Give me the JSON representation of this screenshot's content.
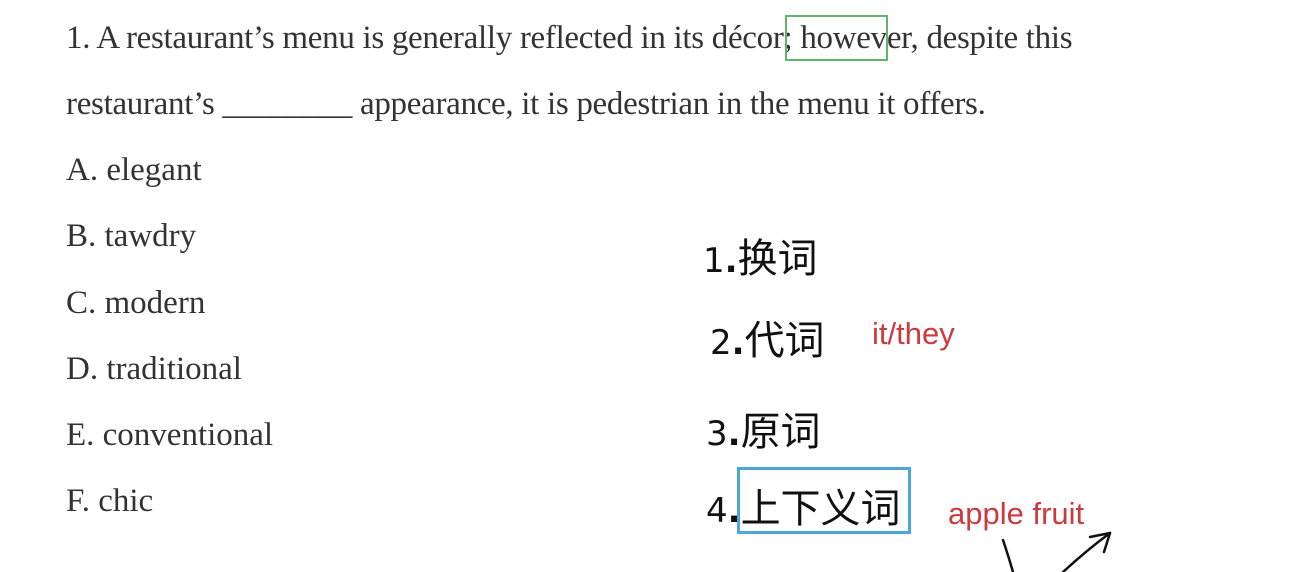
{
  "question": {
    "line1": "1. A restaurant’s menu is generally reflected in its décor; however, despite this",
    "line2": "restaurant’s ________ appearance, it is pedestrian in the menu it offers."
  },
  "options": [
    "A. elegant",
    "B. tawdry",
    "C. modern",
    "D. traditional",
    "E. conventional",
    "F. chic"
  ],
  "notes": [
    {
      "num": "1",
      "label": "换词"
    },
    {
      "num": "2",
      "label": "代词"
    },
    {
      "num": "3",
      "label": "原词"
    },
    {
      "num": "4",
      "label": "上下义词"
    }
  ],
  "annotations": {
    "pronoun_example": "it/they",
    "hypernym_example": "apple fruit"
  },
  "colors": {
    "green_highlight": "#5fb56a",
    "blue_highlight": "#4aa7dd",
    "red_ink": "#cc3b3b"
  }
}
